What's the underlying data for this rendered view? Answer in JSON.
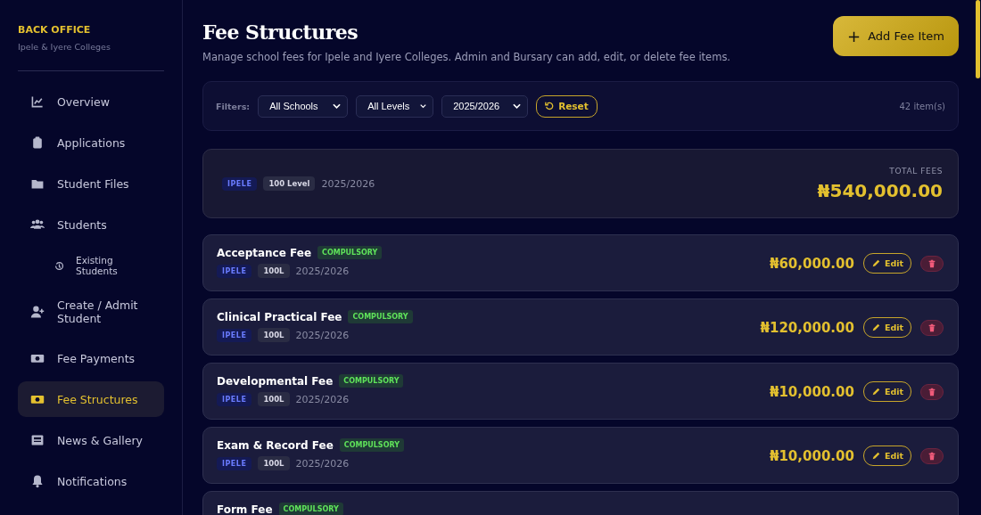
{
  "sidebar": {
    "brand": "BACK OFFICE",
    "subtitle": "Ipele & Iyere Colleges",
    "items": [
      {
        "label": "Overview",
        "kind": "chart",
        "selected": false
      },
      {
        "label": "Applications",
        "kind": "clipboard",
        "selected": false
      },
      {
        "label": "Student Files",
        "kind": "folder",
        "selected": false
      },
      {
        "label": "Students",
        "kind": "users",
        "selected": false,
        "children": [
          {
            "label": "Existing Students",
            "kind": "history",
            "selected": false
          }
        ]
      },
      {
        "label": "Create / Admit Student",
        "kind": "user-plus",
        "selected": false
      },
      {
        "label": "Fee Payments",
        "kind": "money",
        "selected": false
      },
      {
        "label": "Fee Structures",
        "kind": "money",
        "selected": true
      },
      {
        "label": "News & Gallery",
        "kind": "news",
        "selected": false
      },
      {
        "label": "Notifications",
        "kind": "bell",
        "selected": false
      }
    ]
  },
  "header": {
    "title": "Fee Structures",
    "description": "Manage school fees for Ipele and Iyere Colleges. Admin and Bursary can add, edit, or delete fee items.",
    "add_button": "Add Fee Item",
    "add_icon": "+"
  },
  "filters": {
    "label": "Filters:",
    "selects": [
      "All Schools",
      "All Levels",
      "2025/2026"
    ],
    "reset": "Reset",
    "count": "42 item(s)"
  },
  "summary": {
    "school": "IPELE",
    "level": "100 Level",
    "session": "2025/2026",
    "total_label": "TOTAL FEES",
    "total": "₦540,000.00"
  },
  "fees": [
    {
      "name": "Acceptance Fee",
      "tag": "COMPULSORY",
      "school": "IPELE",
      "level": "100L",
      "session": "2025/2026",
      "amount": "₦60,000.00",
      "edit": "Edit"
    },
    {
      "name": "Clinical Practical Fee",
      "tag": "COMPULSORY",
      "school": "IPELE",
      "level": "100L",
      "session": "2025/2026",
      "amount": "₦120,000.00",
      "edit": "Edit"
    },
    {
      "name": "Developmental Fee",
      "tag": "COMPULSORY",
      "school": "IPELE",
      "level": "100L",
      "session": "2025/2026",
      "amount": "₦10,000.00",
      "edit": "Edit"
    },
    {
      "name": "Exam & Record Fee",
      "tag": "COMPULSORY",
      "school": "IPELE",
      "level": "100L",
      "session": "2025/2026",
      "amount": "₦10,000.00",
      "edit": "Edit"
    },
    {
      "name": "Form Fee",
      "tag": "COMPULSORY"
    }
  ]
}
